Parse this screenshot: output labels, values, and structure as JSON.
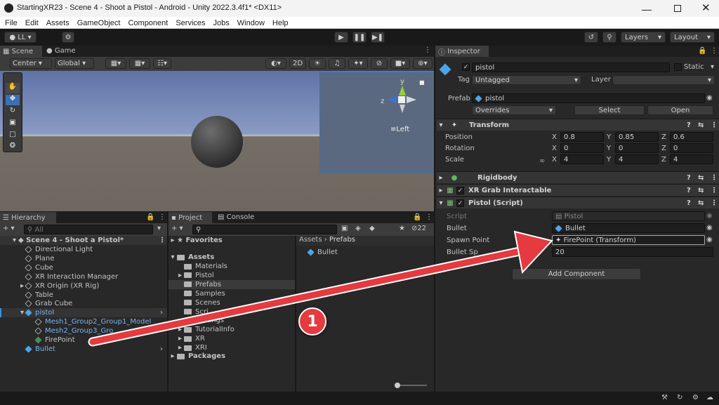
{
  "window": {
    "title": "StartingXR23 - Scene 4 - Shoot a Pistol - Android - Unity 2022.3.4f1* <DX11>"
  },
  "menu": [
    "File",
    "Edit",
    "Assets",
    "GameObject",
    "Component",
    "Services",
    "Jobs",
    "Window",
    "Help"
  ],
  "toolbar": {
    "account": "LL",
    "layers": "Layers",
    "layout": "Layout"
  },
  "scene": {
    "tab_scene": "Scene",
    "tab_game": "Game",
    "pivot": "Center",
    "space": "Global",
    "mode_2d": "2D",
    "gizmo_view": "Left",
    "axis_x": "x",
    "axis_y": "y",
    "axis_z": "z"
  },
  "hierarchy": {
    "tab": "Hierarchy",
    "search_placeholder": "All",
    "scene_name": "Scene 4 - Shoot a Pistol*",
    "items": [
      {
        "label": "Directional Light",
        "type": "obj"
      },
      {
        "label": "Plane",
        "type": "obj"
      },
      {
        "label": "Cube",
        "type": "obj"
      },
      {
        "label": "XR Interaction Manager",
        "type": "obj"
      },
      {
        "label": "XR Origin (XR Rig)",
        "type": "obj"
      },
      {
        "label": "Table",
        "type": "obj"
      },
      {
        "label": "Grab Cube",
        "type": "obj"
      },
      {
        "label": "pistol",
        "type": "prefab"
      },
      {
        "label": "Mesh1_Group2_Group1_Model",
        "type": "child"
      },
      {
        "label": "Mesh2_Group3_Gro",
        "type": "child"
      },
      {
        "label": "FirePoint",
        "type": "fire"
      },
      {
        "label": "Bullet",
        "type": "prefab"
      }
    ]
  },
  "project": {
    "tab_project": "Project",
    "tab_console": "Console",
    "hidden_count": "22",
    "favorites": "Favorites",
    "assets": "Assets",
    "packages": "Packages",
    "folders": [
      "Materials",
      "Pistol",
      "Prefabs",
      "Samples",
      "Scenes",
      "Scri",
      "Settings",
      "TutorialInfo",
      "XR",
      "XRI"
    ],
    "breadcrumb_root": "Assets",
    "breadcrumb_leaf": "Prefabs",
    "files": [
      "Bullet"
    ]
  },
  "inspector": {
    "tab": "Inspector",
    "object_name": "pistol",
    "static_label": "Static",
    "tag_label": "Tag",
    "tag_value": "Untagged",
    "layer_label": "Layer",
    "layer_value": "",
    "prefab_label": "Prefab",
    "prefab_value": "pistol",
    "overrides": "Overrides",
    "select": "Select",
    "open": "Open",
    "transform": {
      "title": "Transform",
      "position_label": "Position",
      "rotation_label": "Rotation",
      "scale_label": "Scale",
      "position": {
        "x": "0.8",
        "y": "0.85",
        "z": "0.6"
      },
      "rotation": {
        "x": "0",
        "y": "0",
        "z": "0"
      },
      "scale": {
        "x": "4",
        "y": "4",
        "z": "4"
      }
    },
    "axis": {
      "x": "X",
      "y": "Y",
      "z": "Z"
    },
    "rigidbody": "Rigidbody",
    "grab": "XR Grab Interactable",
    "script_comp": "Pistol (Script)",
    "script_label": "Script",
    "script_value": "Pistol",
    "bullet_label": "Bullet",
    "bullet_value": "Bullet",
    "spawn_label": "Spawn Point",
    "spawn_value": "FirePoint (Transform)",
    "speed_label": "Bullet Sp",
    "speed_value": "20",
    "add_component": "Add Component"
  },
  "annotation": {
    "number": "1",
    "color": "#e53a3f"
  }
}
